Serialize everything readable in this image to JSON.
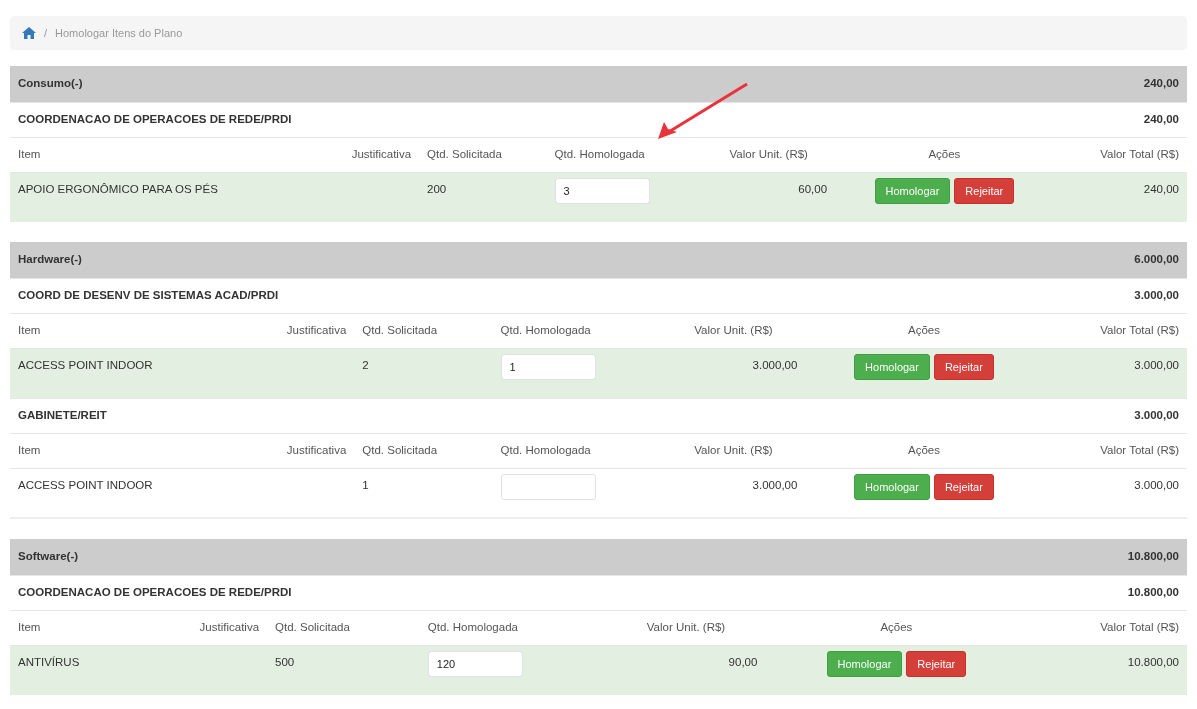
{
  "breadcrumb": {
    "separator": "/",
    "current": "Homologar Itens do Plano"
  },
  "annotation": {
    "kind": "arrow"
  },
  "categories": [
    {
      "name": "Consumo(-)",
      "total": "240,00",
      "groups": [
        {
          "name": "COORDENACAO DE OPERACOES DE REDE/PRDI",
          "total": "240,00",
          "columns": [
            "Item",
            "Justificativa",
            "Qtd. Solicitada",
            "Qtd. Homologada",
            "Valor Unit. (R$)",
            "Ações",
            "Valor Total (R$)"
          ],
          "rows": [
            {
              "item": "APOIO ERGONÔMICO PARA OS PÉS",
              "qtd_solicitada": "200",
              "qtd_homologada": "3",
              "valor_unit": "60,00",
              "valor_total": "240,00",
              "highlighted": true,
              "actions": [
                {
                  "label": "Homologar",
                  "kind": "approve"
                },
                {
                  "label": "Rejeitar",
                  "kind": "reject"
                }
              ]
            }
          ]
        }
      ]
    },
    {
      "name": "Hardware(-)",
      "total": "6.000,00",
      "groups": [
        {
          "name": "COORD DE DESENV DE SISTEMAS ACAD/PRDI",
          "total": "3.000,00",
          "columns": [
            "Item",
            "Justificativa",
            "Qtd. Solicitada",
            "Qtd. Homologada",
            "Valor Unit. (R$)",
            "Ações",
            "Valor Total (R$)"
          ],
          "rows": [
            {
              "item": "ACCESS POINT INDOOR",
              "qtd_solicitada": "2",
              "qtd_homologada": "1",
              "valor_unit": "3.000,00",
              "valor_total": "3.000,00",
              "highlighted": true,
              "actions": [
                {
                  "label": "Homologar",
                  "kind": "approve"
                },
                {
                  "label": "Rejeitar",
                  "kind": "reject"
                }
              ]
            }
          ]
        },
        {
          "name": "GABINETE/REIT",
          "total": "3.000,00",
          "columns": [
            "Item",
            "Justificativa",
            "Qtd. Solicitada",
            "Qtd. Homologada",
            "Valor Unit. (R$)",
            "Ações",
            "Valor Total (R$)"
          ],
          "rows": [
            {
              "item": "ACCESS POINT INDOOR",
              "qtd_solicitada": "1",
              "valor_unit": "3.000,00",
              "valor_total": "3.000,00",
              "highlighted": false,
              "actions": [
                {
                  "label": "Homologar",
                  "kind": "approve"
                },
                {
                  "label": "Rejeitar",
                  "kind": "reject"
                }
              ]
            }
          ]
        }
      ]
    },
    {
      "name": "Software(-)",
      "total": "10.800,00",
      "groups": [
        {
          "name": "COORDENACAO DE OPERACOES DE REDE/PRDI",
          "total": "10.800,00",
          "columns": [
            "Item",
            "Justificativa",
            "Qtd. Solicitada",
            "Qtd. Homologada",
            "Valor Unit. (R$)",
            "Ações",
            "Valor Total (R$)"
          ],
          "rows": [
            {
              "item": "ANTIVÍRUS",
              "qtd_solicitada": "500",
              "qtd_homologada": "120",
              "valor_unit": "90,00",
              "valor_total": "10.800,00",
              "highlighted": true,
              "actions": [
                {
                  "label": "Homologar",
                  "kind": "approve"
                },
                {
                  "label": "Rejeitar",
                  "kind": "reject"
                }
              ]
            }
          ]
        }
      ]
    }
  ]
}
